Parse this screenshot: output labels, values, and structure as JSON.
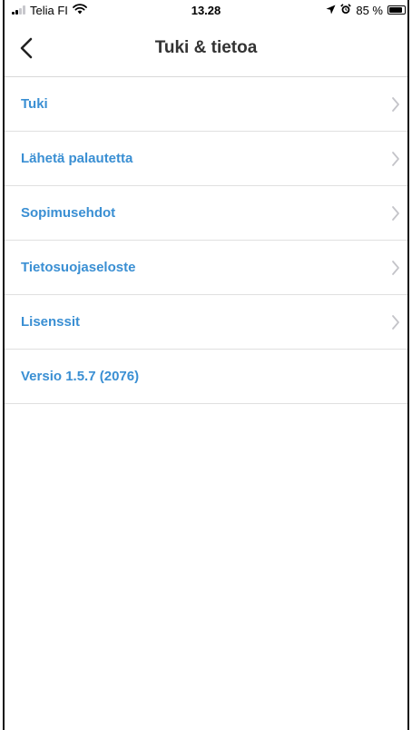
{
  "status_bar": {
    "carrier": "Telia FI",
    "time": "13.28",
    "battery": "85 %",
    "battery_level": 0.85
  },
  "nav": {
    "title": "Tuki & tietoa"
  },
  "list": {
    "items": [
      {
        "label": "Tuki"
      },
      {
        "label": "Lähetä palautetta"
      },
      {
        "label": "Sopimusehdot"
      },
      {
        "label": "Tietosuojaseloste"
      },
      {
        "label": "Lisenssit"
      }
    ],
    "version": "Versio 1.5.7 (2076)"
  },
  "colors": {
    "accent": "#3a8fd3",
    "title": "#333333",
    "chevron": "#c4c4c9",
    "divider": "#e0e0e0"
  },
  "icons": {
    "back": "chevron-left-icon",
    "disclosure": "chevron-right-icon",
    "wifi": "wifi-icon",
    "location": "location-arrow-icon",
    "alarm": "alarm-icon",
    "battery": "battery-icon",
    "signal": "signal-bars-icon"
  }
}
